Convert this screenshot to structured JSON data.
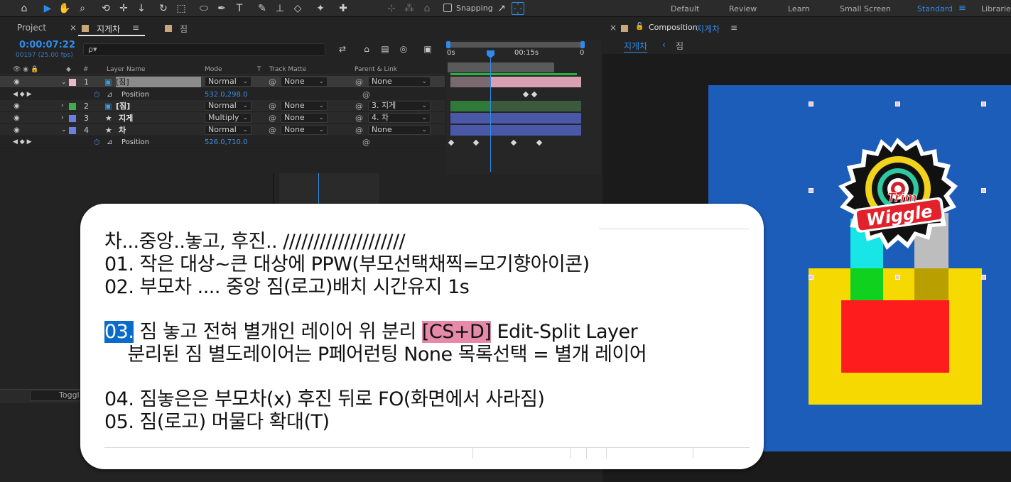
{
  "workspace": {
    "snapping_label": "Snapping",
    "tabs": [
      "Default",
      "Review",
      "Learn",
      "Small Screen",
      "Standard",
      "Libraries"
    ],
    "active": "Standard"
  },
  "project_panel": {
    "tab_project": "Project",
    "tab_comp1": "지게차",
    "tab_comp2": "짐"
  },
  "timeline": {
    "timecode": "0:00:07:22",
    "frame_info": "00197 (25.00 fps)",
    "search_icon": "ρ▾",
    "columns": {
      "layer_name": "Layer Name",
      "mode": "Mode",
      "t": "T",
      "track_matte": "Track Matte",
      "parent": "Parent & Link"
    },
    "layers": [
      {
        "num": "1",
        "name": "[짐]",
        "mode": "Normal",
        "matte": "None",
        "parent": "None",
        "color": "#e9b7c8"
      },
      {
        "num": "2",
        "name": "[짐]",
        "mode": "Normal",
        "matte": "None",
        "parent": "3. 지게",
        "color": "#3fae4a"
      },
      {
        "num": "3",
        "name": "지게",
        "mode": "Multiply",
        "matte": "None",
        "parent": "4. 차",
        "color": "#6b7fe0"
      },
      {
        "num": "4",
        "name": "차",
        "mode": "Normal",
        "matte": "None",
        "parent": "None",
        "color": "#6b7fe0"
      }
    ],
    "prop1": {
      "name": "Position",
      "value": "532.0,298.0"
    },
    "prop4": {
      "name": "Position",
      "value": "526.0,710.0"
    },
    "ruler": [
      "0s",
      "00:15s",
      "0"
    ],
    "toggle_label": "Toggl"
  },
  "composition": {
    "label": "Composition",
    "name": "지게차",
    "breadcrumb_active": "지게차",
    "breadcrumb_next": "짐"
  },
  "logo": {
    "line1": "Trim",
    "line2": "Wiggle"
  },
  "note": {
    "line1": "차...중앙..놓고, 후진.. ////////////////////",
    "line2": "01. 작은 대상~큰 대상에 PPW(부모선택채찍=모기향아이콘)",
    "line3": "02. 부모차 .... 중앙 짐(로고)배치 시간유지 1s",
    "line4_num": "03.",
    "line4_a": " 짐 놓고 전혀 별개인 레이어 위 분리 ",
    "line4_hl": "[CS+D]",
    "line4_b": " Edit-Split Layer",
    "line5": "    분리된 짐 별도레이어는 P페어런팅 None 목록선택 = 별개 레이어",
    "line6": "04. 짐놓은은 부모차(x) 후진 뒤로 FO(화면에서 사라짐)",
    "line7": "05. 짐(로고) 머물다 확대(T)"
  }
}
